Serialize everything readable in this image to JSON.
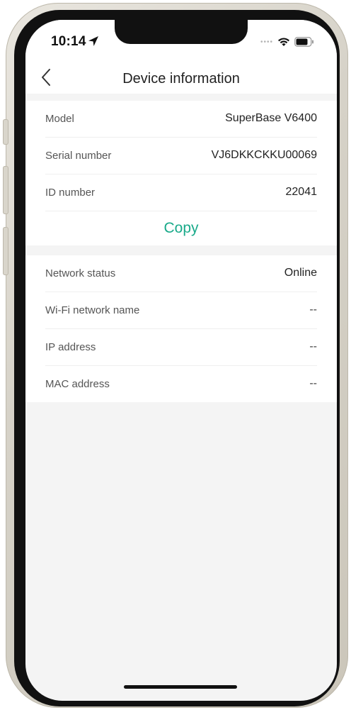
{
  "status_bar": {
    "time": "10:14",
    "icons": [
      "location-arrow-icon",
      "wifi-icon",
      "battery-icon"
    ]
  },
  "header": {
    "title": "Device information",
    "back_icon": "chevron-left-icon"
  },
  "device_section": {
    "rows": [
      {
        "label": "Model",
        "value": "SuperBase V6400"
      },
      {
        "label": "Serial number",
        "value": "VJ6DKKCKKU00069"
      },
      {
        "label": "ID number",
        "value": "22041"
      }
    ],
    "copy_label": "Copy"
  },
  "network_section": {
    "rows": [
      {
        "label": "Network status",
        "value": "Online"
      },
      {
        "label": "Wi-Fi network name",
        "value": "--"
      },
      {
        "label": "IP address",
        "value": "--"
      },
      {
        "label": "MAC address",
        "value": "--"
      }
    ]
  },
  "colors": {
    "accent": "#1aaa8a",
    "background": "#f4f4f4",
    "card": "#ffffff"
  }
}
